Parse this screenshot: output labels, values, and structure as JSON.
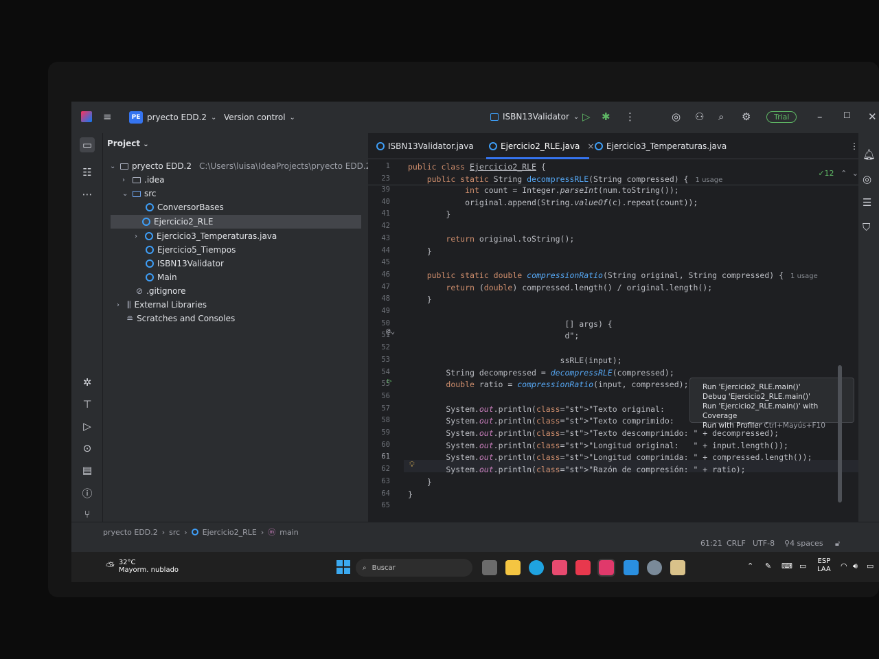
{
  "titlebar": {
    "project_badge": "PE",
    "project_name": "pryecto EDD.2",
    "vcs_label": "Version control",
    "run_config": "ISBN13Validator",
    "trial": "Trial"
  },
  "project_panel": {
    "header": "Project",
    "root_name": "pryecto EDD.2",
    "root_path": "C:\\Users\\luisa\\IdeaProjects\\pryecto EDD.2",
    "items": [
      {
        "label": ".idea",
        "kind": "folder"
      },
      {
        "label": "src",
        "kind": "src-folder"
      },
      {
        "label": "ConversorBases",
        "kind": "class"
      },
      {
        "label": "Ejercicio2_RLE",
        "kind": "class"
      },
      {
        "label": "Ejercicio3_Temperaturas.java",
        "kind": "class"
      },
      {
        "label": "Ejercicio5_Tiempos",
        "kind": "class"
      },
      {
        "label": "ISBN13Validator",
        "kind": "class"
      },
      {
        "label": "Main",
        "kind": "class"
      },
      {
        "label": ".gitignore",
        "kind": "ignore"
      },
      {
        "label": "External Libraries",
        "kind": "library"
      },
      {
        "label": "Scratches and Consoles",
        "kind": "scratch"
      }
    ]
  },
  "tabs": [
    {
      "label": "ISBN13Validator.java"
    },
    {
      "label": "Ejercicio2_RLE.java"
    },
    {
      "label": "Ejercicio3_Temperaturas.java"
    }
  ],
  "editor": {
    "problems_count": "✓12",
    "sticky": [
      {
        "ln": "1",
        "text": "public class Ejercicio2_RLE {"
      },
      {
        "ln": "23",
        "text": "    public static String decompressRLE(String compressed) {",
        "hint": "1 usage"
      }
    ],
    "lines": [
      {
        "ln": "39",
        "text": "            int count = Integer.parseInt(num.toString());"
      },
      {
        "ln": "40",
        "text": "            original.append(String.valueOf(c).repeat(count));"
      },
      {
        "ln": "41",
        "text": "        }"
      },
      {
        "ln": "42",
        "text": ""
      },
      {
        "ln": "43",
        "text": "        return original.toString();"
      },
      {
        "ln": "44",
        "text": "    }"
      },
      {
        "ln": "45",
        "text": ""
      },
      {
        "ln": "46",
        "text": "    public static double compressionRatio(String original, String compressed) {",
        "hint": "1 usage"
      },
      {
        "ln": "47",
        "text": "        return (double) compressed.length() / original.length();"
      },
      {
        "ln": "48",
        "text": "    }"
      },
      {
        "ln": "49",
        "text": ""
      },
      {
        "ln": "50",
        "text": "                                 [] args) {"
      },
      {
        "ln": "51",
        "text": "                                 d\";"
      },
      {
        "ln": "52",
        "text": ""
      },
      {
        "ln": "53",
        "text": "                                ssRLE(input);"
      },
      {
        "ln": "54",
        "text": "        String decompressed = decompressRLE(compressed);"
      },
      {
        "ln": "55",
        "text": "        double ratio = compressionRatio(input, compressed);"
      },
      {
        "ln": "56",
        "text": ""
      },
      {
        "ln": "57",
        "text": "        System.out.println(\"Texto original:      \" + input);"
      },
      {
        "ln": "58",
        "text": "        System.out.println(\"Texto comprimido:    \" + compressed);"
      },
      {
        "ln": "59",
        "text": "        System.out.println(\"Texto descomprimido: \" + decompressed);"
      },
      {
        "ln": "60",
        "text": "        System.out.println(\"Longitud original:   \" + input.length());"
      },
      {
        "ln": "61",
        "text": "        System.out.println(\"Longitud comprimida: \" + compressed.length());"
      },
      {
        "ln": "62",
        "text": "        System.out.println(\"Razón de compresión: \" + ratio);"
      },
      {
        "ln": "63",
        "text": "    }"
      },
      {
        "ln": "64",
        "text": "}"
      },
      {
        "ln": "65",
        "text": ""
      }
    ],
    "popup": [
      "Run 'Ejercicio2_RLE.main()'",
      "Debug 'Ejercicio2_RLE.main()'",
      "Run 'Ejercicio2_RLE.main()' with Coverage",
      "Run with Profiler",
      "Ctrl+Mayús+F10"
    ]
  },
  "breadcrumb": [
    "pryecto EDD.2",
    "src",
    "Ejercicio2_RLE",
    "main"
  ],
  "status": {
    "position": "61:21",
    "line_sep": "CRLF",
    "encoding": "UTF-8",
    "indent": "4 spaces"
  },
  "taskbar": {
    "temp": "32°C",
    "weather": "Mayorm. nublado",
    "search": "Buscar",
    "lang1": "ESP",
    "lang2": "LAA"
  }
}
